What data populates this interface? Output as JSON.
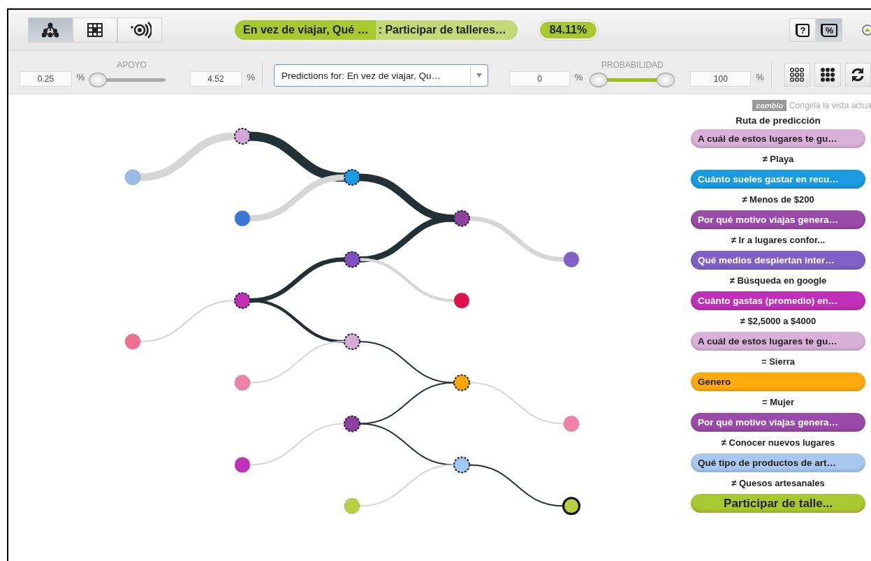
{
  "views": [
    {
      "selected": true
    },
    {
      "selected": false
    },
    {
      "selected": false
    }
  ],
  "title": {
    "question": "En vez de viajar, Qué …",
    "answer": ": Participar de talleres…",
    "confidence": "84.11%"
  },
  "toggles": [
    {
      "symbol": "?",
      "selected": false
    },
    {
      "symbol": "%",
      "selected": true
    }
  ],
  "support": {
    "label": "APOYO",
    "min": "0.25",
    "max": "4.52",
    "unit": "%",
    "level": 0
  },
  "dropdown": {
    "value": "Predictions for: En vez de viajar, Qu…"
  },
  "probability": {
    "label": "PROBABILIDAD",
    "min": "0",
    "max": "100",
    "unit": "%",
    "level": 1
  },
  "tree": {
    "color": "#d4a8d4",
    "on_path": true,
    "children": [
      {
        "color": "#9bbbe8",
        "on_path": false
      },
      {
        "color": "#1a9ae0",
        "on_path": true,
        "children": [
          {
            "color": "#3a78d8",
            "on_path": false
          },
          {
            "color": "#9040a0",
            "on_path": true,
            "children": [
              {
                "color": "#8050c0",
                "on_path": true,
                "children": [
                  {
                    "color": "#c030b8",
                    "on_path": true,
                    "children": [
                      {
                        "color": "#f07090",
                        "on_path": false
                      },
                      {
                        "color": "#d8a8d8",
                        "on_path": true,
                        "children": [
                          {
                            "color": "#f080a8",
                            "on_path": false
                          },
                          {
                            "color": "#ffa500",
                            "on_path": true,
                            "children": [
                              {
                                "color": "#9040a0",
                                "on_path": true,
                                "children": [
                                  {
                                    "color": "#c030b8",
                                    "on_path": false
                                  },
                                  {
                                    "color": "#a0c8f0",
                                    "on_path": true,
                                    "children": [
                                      {
                                        "color": "#b8d040",
                                        "on_path": false
                                      },
                                      {
                                        "color": "#b8d040",
                                        "on_path": true
                                      }
                                    ]
                                  }
                                ]
                              },
                              {
                                "color": "#f080a8",
                                "on_path": false
                              }
                            ]
                          }
                        ]
                      }
                    ]
                  },
                  {
                    "color": "#e0104a",
                    "on_path": false
                  }
                ]
              },
              {
                "color": "#8060c8",
                "on_path": false
              }
            ]
          }
        ]
      }
    ]
  },
  "panel": {
    "tag": "cambio",
    "hint": "Congela la vista actua",
    "heading": "Ruta de predicción",
    "items": [
      {
        "kind": "node",
        "text": "A cuál de estos lugares te gu…",
        "color": "#d8b0d8"
      },
      {
        "kind": "condition",
        "text": "≠ Playa"
      },
      {
        "kind": "node",
        "text": "Cuánto sueles gastar en recu…",
        "color": "#1a9ae0"
      },
      {
        "kind": "condition",
        "text": "≠ Menos de $200"
      },
      {
        "kind": "node",
        "text": "Por qué motivo viajas genera…",
        "color": "#9a4aa8"
      },
      {
        "kind": "condition",
        "text": "≠ Ir a lugares confor..."
      },
      {
        "kind": "node",
        "text": "Qué medios despiertan inter…",
        "color": "#8060c8"
      },
      {
        "kind": "condition",
        "text": "≠ Búsqueda en google"
      },
      {
        "kind": "node",
        "text": "Cuánto gastas (promedio) en…",
        "color": "#c030b8"
      },
      {
        "kind": "condition",
        "text": "≠ $2,5000 a $4000"
      },
      {
        "kind": "node",
        "text": "A cuál de estos lugares te gu…",
        "color": "#d8b0d8"
      },
      {
        "kind": "condition",
        "text": "= Sierra"
      },
      {
        "kind": "node",
        "text": "Genero",
        "color": "#ffaa10"
      },
      {
        "kind": "condition",
        "text": "= Mujer"
      },
      {
        "kind": "node",
        "text": "Por qué motivo viajas genera…",
        "color": "#9a4aa8"
      },
      {
        "kind": "condition",
        "text": "≠ Conocer nuevos lugares"
      },
      {
        "kind": "node",
        "text": "Qué tipo de productos de art…",
        "color": "#a8c8f0"
      },
      {
        "kind": "condition",
        "text": "≠ Quesos artesanales"
      },
      {
        "kind": "result",
        "text": "Participar de talle...",
        "color": "#a8c830"
      }
    ]
  }
}
